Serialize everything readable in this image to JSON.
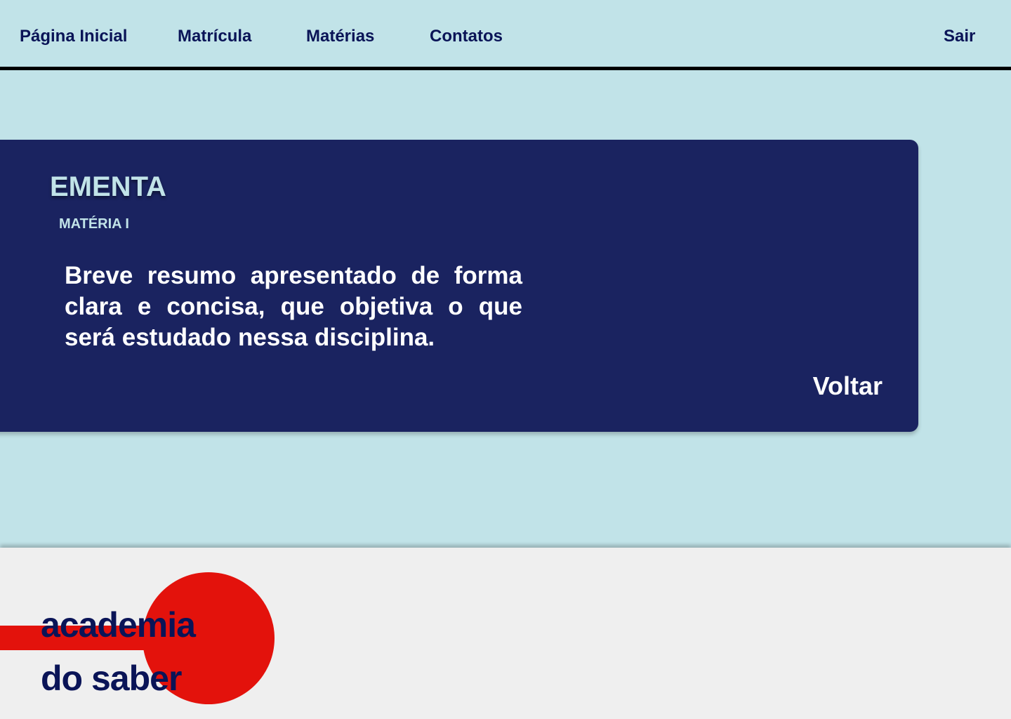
{
  "nav": {
    "home": "Página Inicial",
    "enrollment": "Matrícula",
    "subjects": "Matérias",
    "contacts": "Contatos",
    "logout": "Sair"
  },
  "ementa": {
    "title": "EMENTA",
    "subtitle": "MATÉRIA I",
    "summary": "Breve resumo apresentado de forma clara e concisa, que objetiva o que será estudado nessa disciplina.",
    "back_label": "Voltar"
  },
  "footer": {
    "logo_line1": "academia",
    "logo_line2": "do saber"
  },
  "colors": {
    "background": "#c1e3e8",
    "card": "#1a2360",
    "nav_text": "#0a1457",
    "accent_red": "#e3120c",
    "footer_bg": "#efefef"
  }
}
